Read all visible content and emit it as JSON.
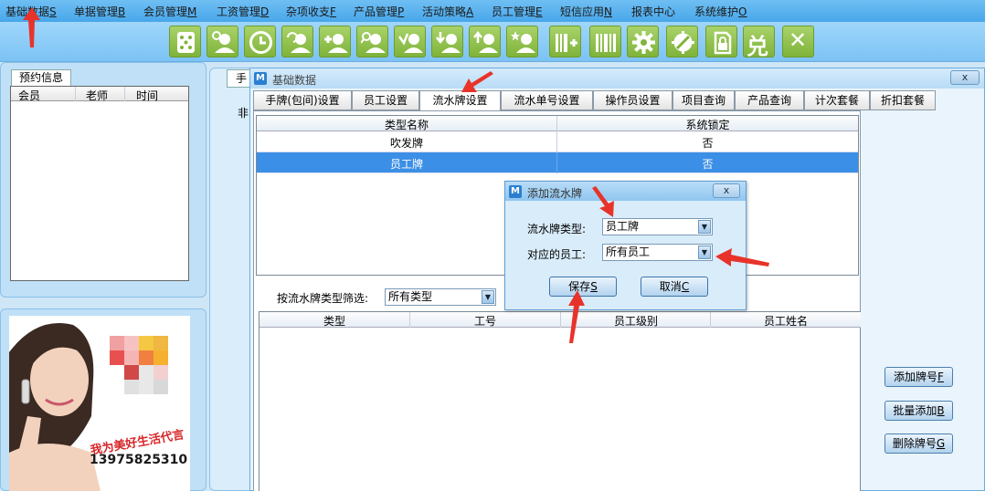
{
  "menu": [
    {
      "label": "基础数据",
      "key": "S"
    },
    {
      "label": "单据管理",
      "key": "B"
    },
    {
      "label": "会员管理",
      "key": "M"
    },
    {
      "label": "工资管理",
      "key": "D"
    },
    {
      "label": "杂项收支",
      "key": "F"
    },
    {
      "label": "产品管理",
      "key": "P"
    },
    {
      "label": "活动策略",
      "key": "A"
    },
    {
      "label": "员工管理",
      "key": "E"
    },
    {
      "label": "短信应用",
      "key": "N"
    },
    {
      "label": "报表中心",
      "key": ""
    },
    {
      "label": "系统维护",
      "key": "O"
    }
  ],
  "toolbar_icons": [
    "dice-icon",
    "user-settings-icon",
    "clock-icon",
    "user-refresh-icon",
    "user-add-icon",
    "user-search-icon",
    "user-checkin-icon",
    "user-download-icon",
    "user-upload-icon",
    "user-star-icon",
    "barcode-plus-icon",
    "barcode-icon",
    "gear-icon",
    "tools-icon",
    "lock-doc-icon",
    "exchange-icon",
    "close-icon"
  ],
  "toolbar_glyphs": {
    "exchange": "兑",
    "close": "✕"
  },
  "appointments": {
    "tab_label": "预约信息",
    "columns": [
      "会员",
      "老师",
      "时间"
    ]
  },
  "ad": {
    "slogan": "我为美好生活代言",
    "phone": "13975825310"
  },
  "back_window": {
    "tab_label": "手牌",
    "text": "非"
  },
  "basic_window": {
    "title": "基础数据",
    "close_label": "x",
    "tabs": [
      "手牌(包间)设置",
      "员工设置",
      "流水牌设置",
      "流水单号设置",
      "操作员设置",
      "项目查询",
      "产品查询",
      "计次套餐",
      "折扣套餐"
    ],
    "active_tab": 2,
    "types_table": {
      "columns": [
        "类型名称",
        "系统锁定"
      ],
      "rows": [
        {
          "name": "吹发牌",
          "locked": "否"
        },
        {
          "name": "员工牌",
          "locked": "否"
        }
      ],
      "selected_row": 1
    },
    "filter": {
      "label": "按流水牌类型筛选:",
      "value": "所有类型"
    },
    "cards_table": {
      "columns": [
        "类型",
        "工号",
        "员工级别",
        "员工姓名"
      ]
    },
    "side_buttons": [
      {
        "label": "添加牌号",
        "key": "F"
      },
      {
        "label": "批量添加",
        "key": "B"
      },
      {
        "label": "删除牌号",
        "key": "G"
      }
    ]
  },
  "dialog": {
    "title": "添加流水牌",
    "close_label": "x",
    "card_type_label": "流水牌类型:",
    "card_type_value": "员工牌",
    "employee_label": "对应的员工:",
    "employee_value": "所有员工",
    "save_label": "保存",
    "save_key": "S",
    "cancel_label": "取消",
    "cancel_key": "C"
  },
  "colors": {
    "menu_bar": "#48a7ea",
    "toolbar_button": "#7fb33a",
    "selection": "#3b8fe6",
    "annotation_arrow": "#e8332a",
    "ad_slogan": "#d8262a"
  }
}
